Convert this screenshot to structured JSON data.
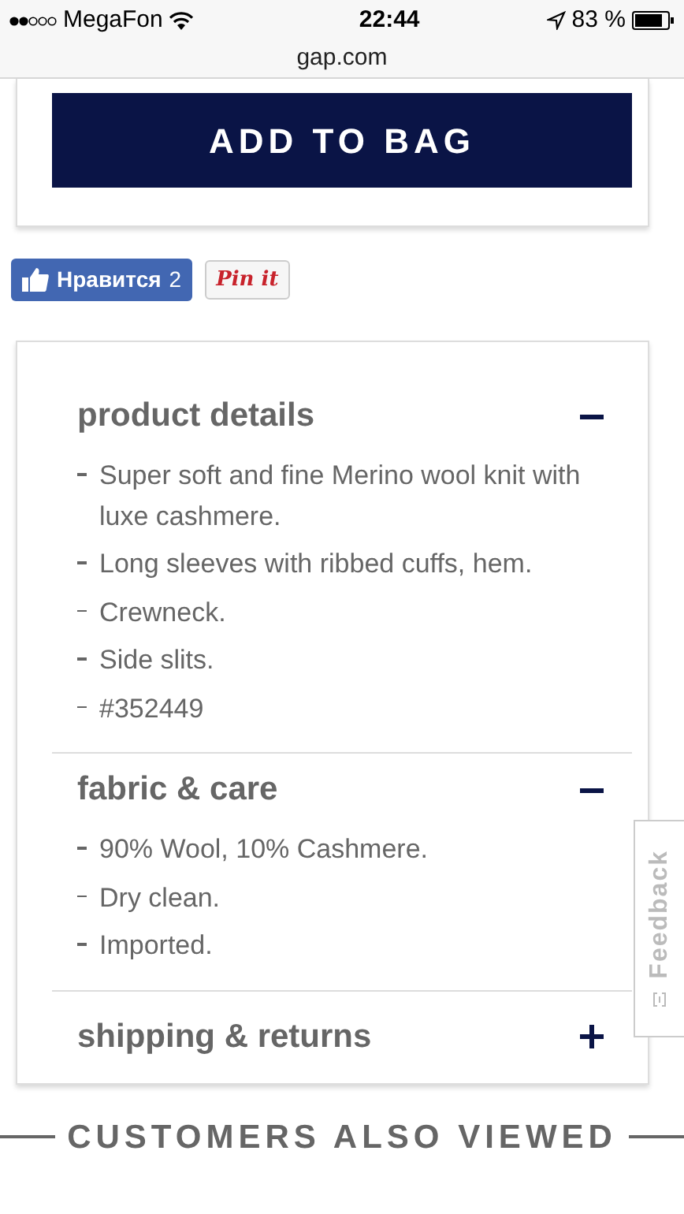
{
  "status_bar": {
    "carrier": "MegaFon",
    "time": "22:44",
    "battery": "83 %"
  },
  "url_bar": {
    "address": "gap.com"
  },
  "add_to_bag": {
    "label": "ADD TO BAG"
  },
  "social": {
    "like_label": "Нравится",
    "like_count": "2",
    "pin_label": "Pin it"
  },
  "sections": [
    {
      "title": "product details",
      "expanded": true,
      "items": [
        "Super soft and fine Merino wool knit with luxe cashmere.",
        "Long sleeves with ribbed cuffs, hem.",
        "Crewneck.",
        "Side slits.",
        "#352449"
      ]
    },
    {
      "title": "fabric & care",
      "expanded": true,
      "items": [
        "90% Wool, 10% Cashmere.",
        "Dry clean.",
        "Imported."
      ]
    },
    {
      "title": "shipping & returns",
      "expanded": false
    }
  ],
  "feedback_tab": {
    "label": "Feedback"
  },
  "also_viewed": {
    "heading": "CUSTOMERS ALSO VIEWED"
  }
}
